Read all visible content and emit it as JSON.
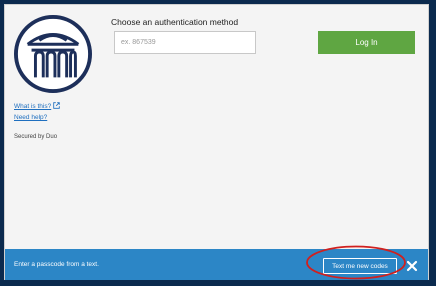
{
  "sidebar": {
    "what_is_this": "What is this?",
    "need_help": "Need help?",
    "secured_by": "Secured by Duo"
  },
  "auth": {
    "heading": "Choose an authentication method",
    "passcode_placeholder": "ex. 867539",
    "login_label": "Log In"
  },
  "message_bar": {
    "text": "Enter a passcode from a text.",
    "text_codes_label": "Text me new codes"
  },
  "colors": {
    "page_background": "#0b2a4e",
    "login_green": "#5fa642",
    "message_blue": "#2c86c6",
    "annotation_red": "#d0201e"
  }
}
